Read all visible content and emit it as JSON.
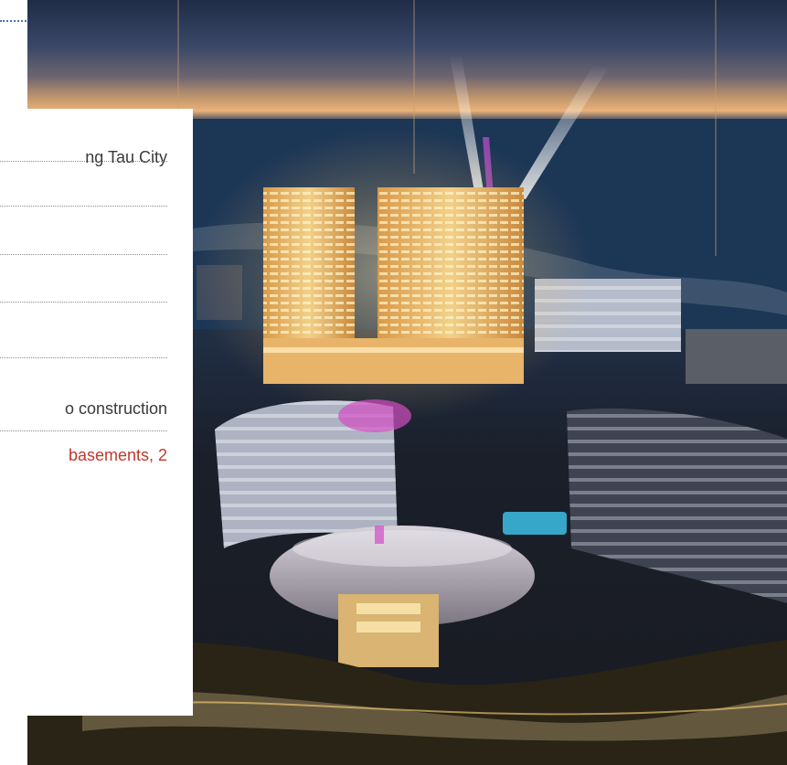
{
  "info_panel": {
    "location_value": "ng Tau City",
    "status_value": "o construction",
    "scale_value": "basements, 2"
  },
  "colors": {
    "highlight": "#c0392b",
    "rule": "#4a72b8",
    "text": "#3a3a3a"
  }
}
